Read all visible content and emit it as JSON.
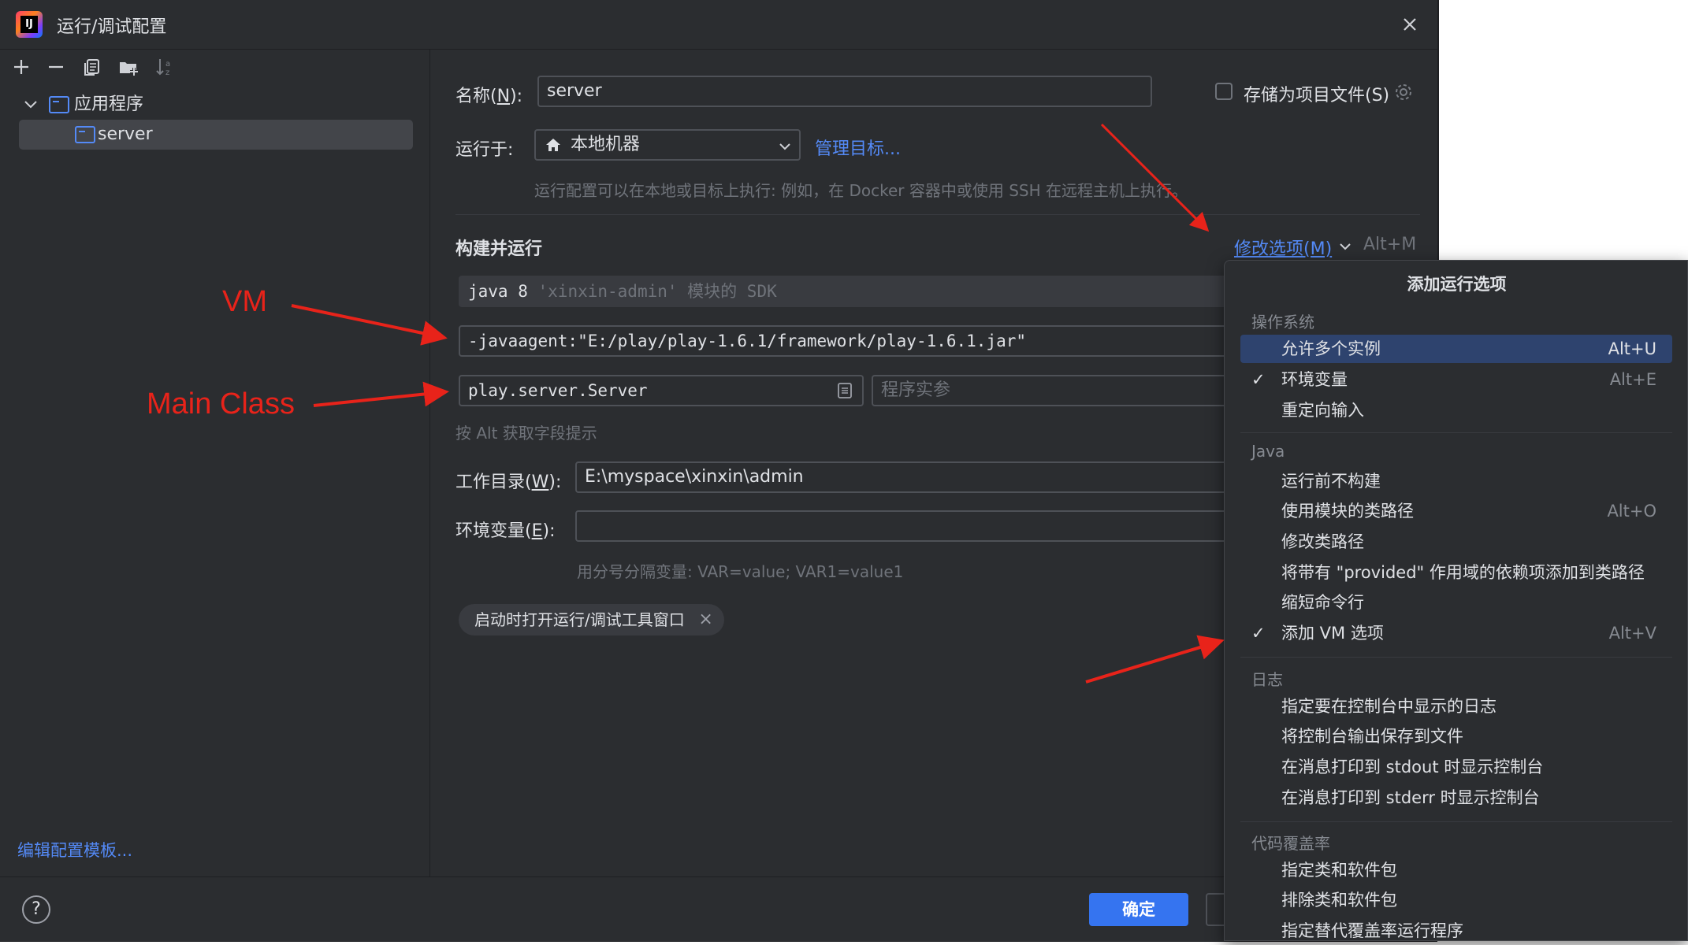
{
  "window": {
    "title": "运行/调试配置"
  },
  "tree": {
    "group_label": "应用程序",
    "item_label": "server",
    "edit_templates": "编辑配置模板..."
  },
  "form": {
    "name_label_pre": "名称(",
    "name_label_key": "N",
    "name_label_post": "):",
    "name_value": "server",
    "store_label": "存储为项目文件(S)",
    "run_on_label": "运行于:",
    "run_on_value": "本地机器",
    "manage_targets": "管理目标...",
    "run_on_hint": "运行配置可以在本地或目标上执行: 例如，在 Docker 容器中或使用 SSH 在远程主机上执行。",
    "build_run_title": "构建并运行",
    "modify_options": "修改选项(M)",
    "modify_shortcut": "Alt+M",
    "sdk_main": "java 8",
    "sdk_hint": "'xinxin-admin' 模块的 SDK",
    "vm_options": "-javaagent:\"E:/play/play-1.6.1/framework/play-1.6.1.jar\"",
    "main_class": "play.server.Server",
    "program_args_placeholder": "程序实参",
    "alt_hint": "按 Alt 获取字段提示",
    "workdir_label_pre": "工作目录(",
    "workdir_label_key": "W",
    "workdir_label_post": "):",
    "workdir_value": "E:\\myspace\\xinxin\\admin",
    "env_label_pre": "环境变量(",
    "env_label_key": "E",
    "env_label_post": "):",
    "env_value": "",
    "env_hint": "用分号分隔变量: VAR=value; VAR1=value1",
    "chip_label": "启动时打开运行/调试工具窗口"
  },
  "buttons": {
    "ok": "确定",
    "help": "?"
  },
  "popup": {
    "title": "添加运行选项",
    "sections": [
      {
        "label": "操作系统",
        "items": [
          {
            "label": "允许多个实例",
            "shortcut": "Alt+U",
            "checked": false,
            "highlighted": true
          },
          {
            "label": "环境变量",
            "shortcut": "Alt+E",
            "checked": true,
            "highlighted": false
          },
          {
            "label": "重定向输入",
            "shortcut": "",
            "checked": false,
            "highlighted": false
          }
        ]
      },
      {
        "label": "Java",
        "items": [
          {
            "label": "运行前不构建",
            "shortcut": "",
            "checked": false
          },
          {
            "label": "使用模块的类路径",
            "shortcut": "Alt+O",
            "checked": false
          },
          {
            "label": "修改类路径",
            "shortcut": "",
            "checked": false
          },
          {
            "label": "将带有 \"provided\" 作用域的依赖项添加到类路径",
            "shortcut": "",
            "checked": false
          },
          {
            "label": "缩短命令行",
            "shortcut": "",
            "checked": false
          },
          {
            "label": "添加 VM 选项",
            "shortcut": "Alt+V",
            "checked": true
          }
        ]
      },
      {
        "label": "日志",
        "items": [
          {
            "label": "指定要在控制台中显示的日志",
            "shortcut": "",
            "checked": false
          },
          {
            "label": "将控制台输出保存到文件",
            "shortcut": "",
            "checked": false
          },
          {
            "label": "在消息打印到 stdout 时显示控制台",
            "shortcut": "",
            "checked": false
          },
          {
            "label": "在消息打印到 stderr 时显示控制台",
            "shortcut": "",
            "checked": false
          }
        ]
      },
      {
        "label": "代码覆盖率",
        "items": [
          {
            "label": "指定类和软件包",
            "shortcut": "",
            "checked": false
          },
          {
            "label": "排除类和软件包",
            "shortcut": "",
            "checked": false
          },
          {
            "label": "指定替代覆盖率运行程序",
            "shortcut": "",
            "checked": false
          }
        ]
      }
    ]
  },
  "annotations": {
    "vm": "VM",
    "main_class": "Main Class"
  },
  "icons": {
    "toolbar": [
      "add-icon",
      "remove-icon",
      "copy-icon",
      "new-folder-icon",
      "sort-icon"
    ],
    "close": "close-icon",
    "home": "home-icon",
    "gear": "gear-icon",
    "browse": "browse-icon"
  },
  "colors": {
    "background": "#2b2d30",
    "accent": "#3574f0",
    "link": "#548af7",
    "annotation": "#e8231a",
    "highlight": "#2e436e"
  }
}
